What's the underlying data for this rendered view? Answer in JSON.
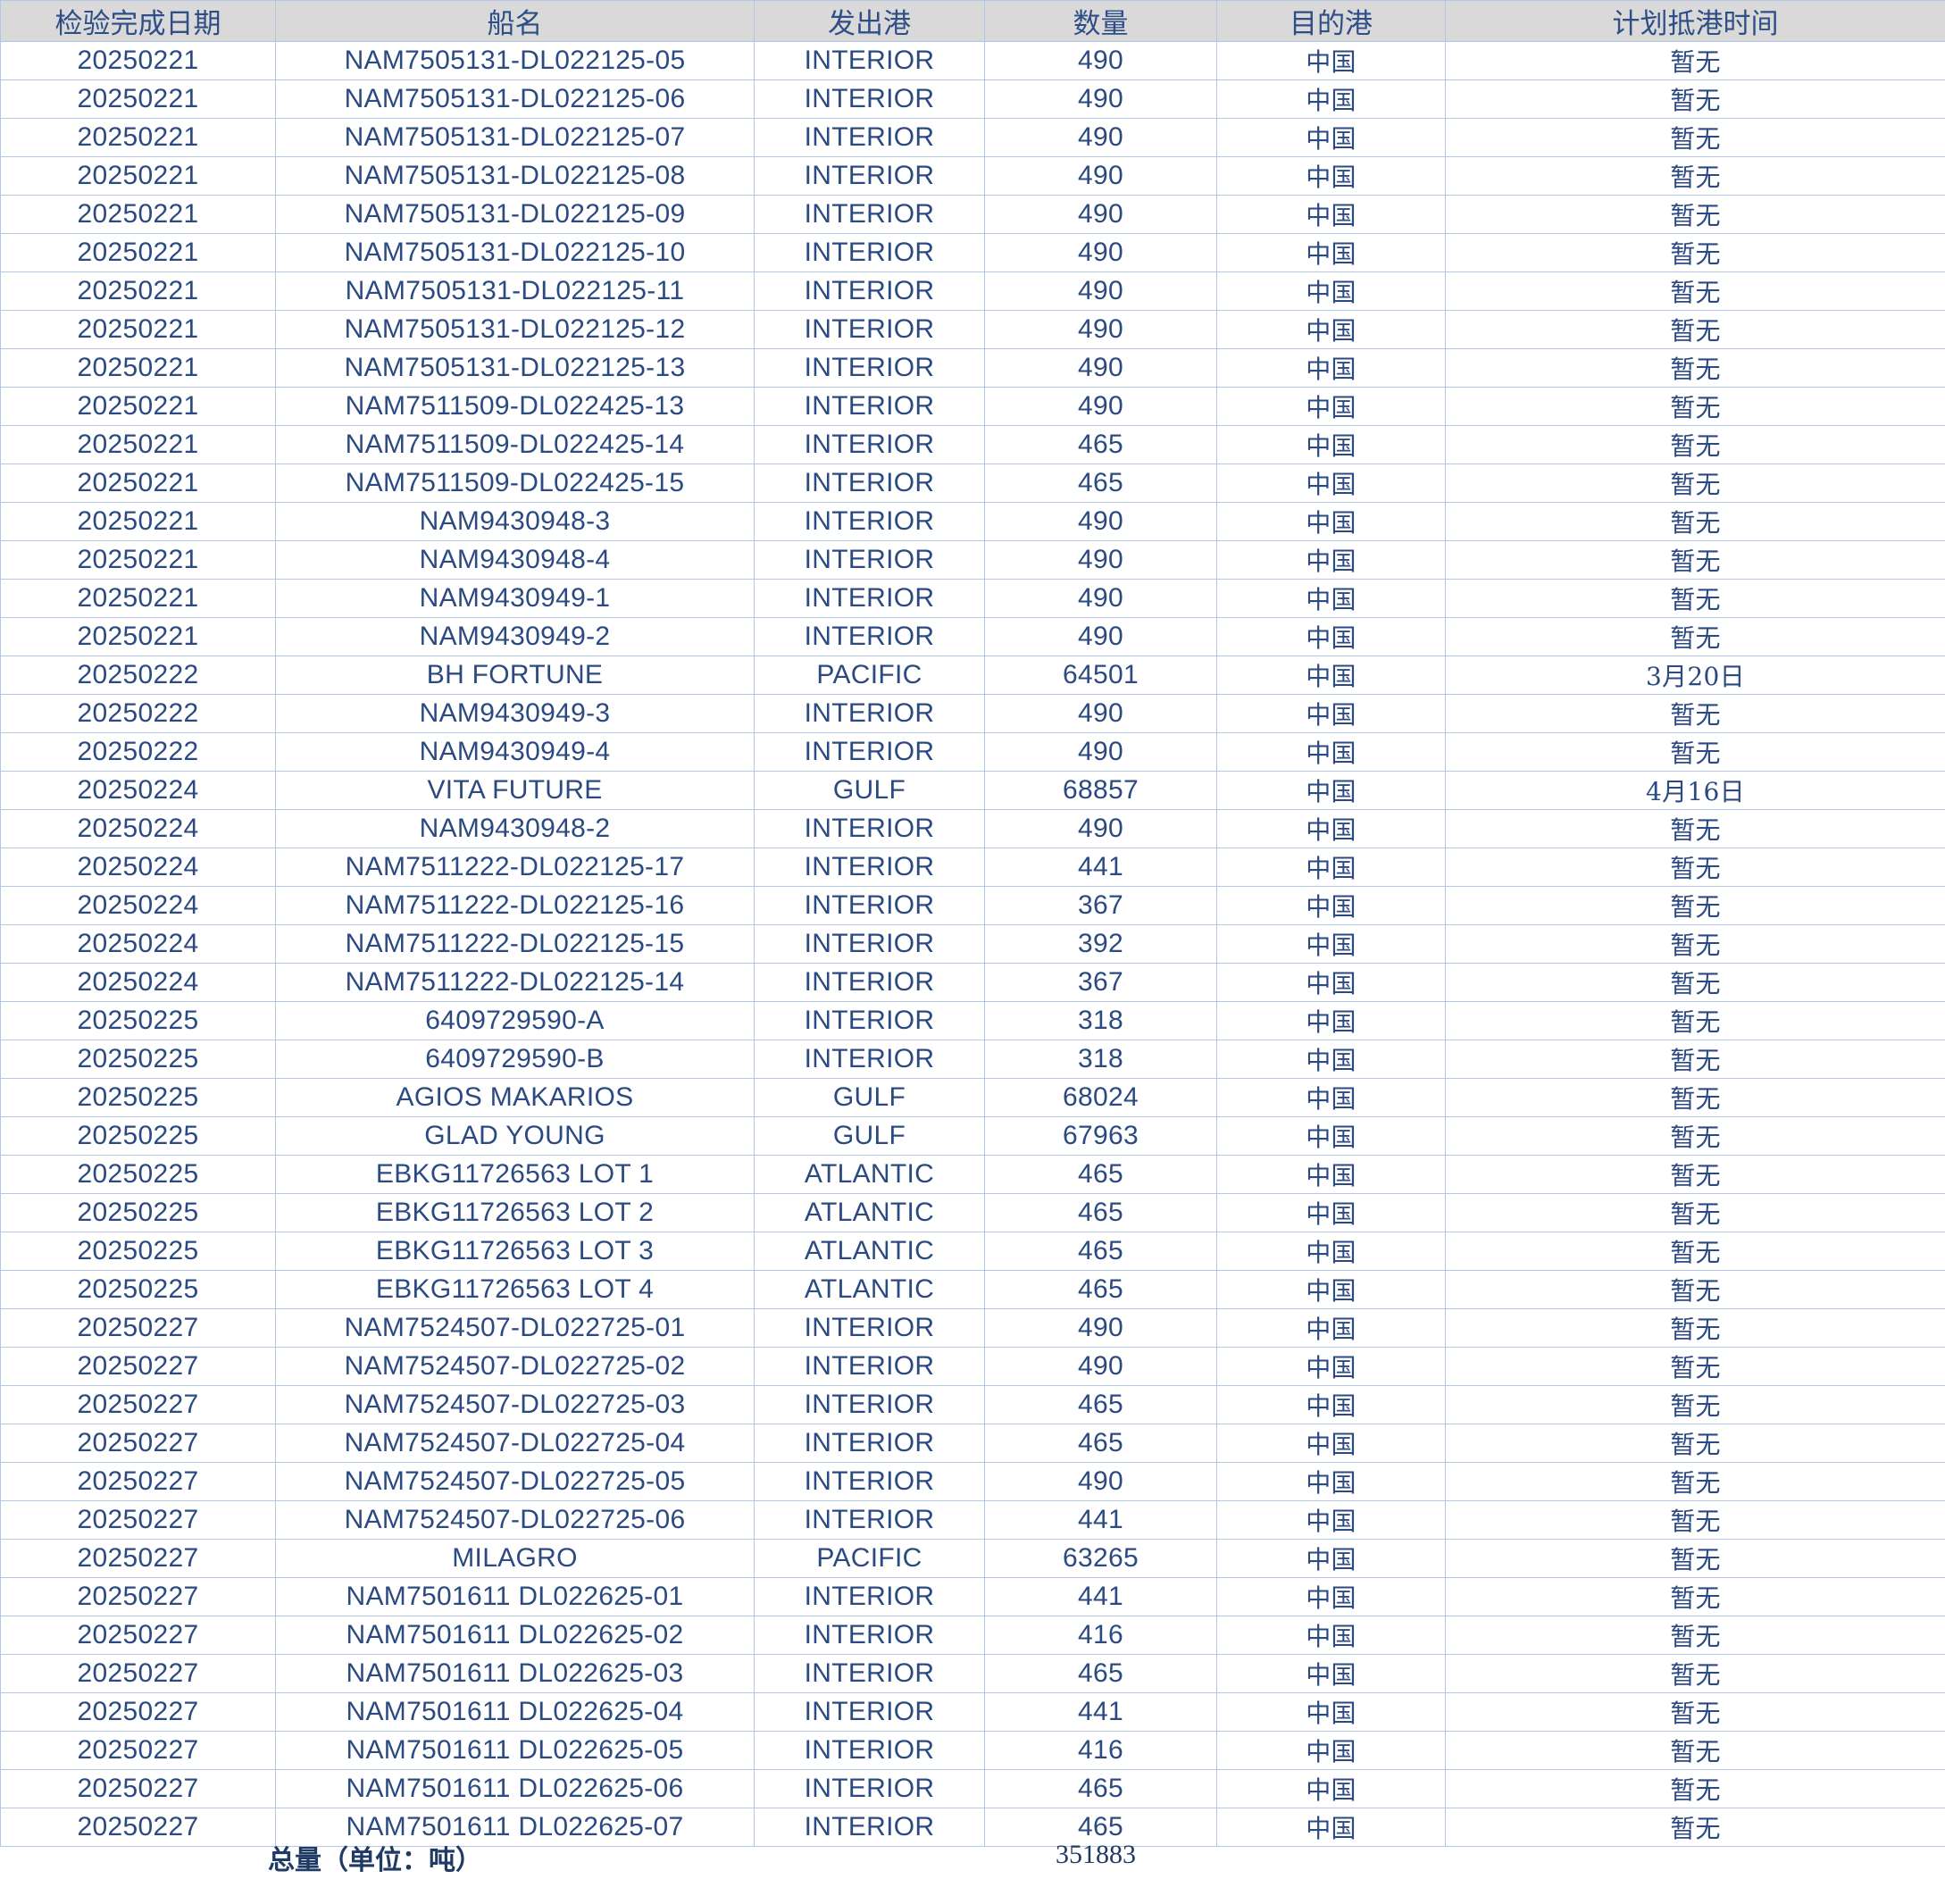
{
  "headers": [
    "检验完成日期",
    "船名",
    "发出港",
    "数量",
    "目的港",
    "计划抵港时间"
  ],
  "rows": [
    [
      "20250221",
      "NAM7505131-DL022125-05",
      "INTERIOR",
      "490",
      "中国",
      "暂无"
    ],
    [
      "20250221",
      "NAM7505131-DL022125-06",
      "INTERIOR",
      "490",
      "中国",
      "暂无"
    ],
    [
      "20250221",
      "NAM7505131-DL022125-07",
      "INTERIOR",
      "490",
      "中国",
      "暂无"
    ],
    [
      "20250221",
      "NAM7505131-DL022125-08",
      "INTERIOR",
      "490",
      "中国",
      "暂无"
    ],
    [
      "20250221",
      "NAM7505131-DL022125-09",
      "INTERIOR",
      "490",
      "中国",
      "暂无"
    ],
    [
      "20250221",
      "NAM7505131-DL022125-10",
      "INTERIOR",
      "490",
      "中国",
      "暂无"
    ],
    [
      "20250221",
      "NAM7505131-DL022125-11",
      "INTERIOR",
      "490",
      "中国",
      "暂无"
    ],
    [
      "20250221",
      "NAM7505131-DL022125-12",
      "INTERIOR",
      "490",
      "中国",
      "暂无"
    ],
    [
      "20250221",
      "NAM7505131-DL022125-13",
      "INTERIOR",
      "490",
      "中国",
      "暂无"
    ],
    [
      "20250221",
      "NAM7511509-DL022425-13",
      "INTERIOR",
      "490",
      "中国",
      "暂无"
    ],
    [
      "20250221",
      "NAM7511509-DL022425-14",
      "INTERIOR",
      "465",
      "中国",
      "暂无"
    ],
    [
      "20250221",
      "NAM7511509-DL022425-15",
      "INTERIOR",
      "465",
      "中国",
      "暂无"
    ],
    [
      "20250221",
      "NAM9430948-3",
      "INTERIOR",
      "490",
      "中国",
      "暂无"
    ],
    [
      "20250221",
      "NAM9430948-4",
      "INTERIOR",
      "490",
      "中国",
      "暂无"
    ],
    [
      "20250221",
      "NAM9430949-1",
      "INTERIOR",
      "490",
      "中国",
      "暂无"
    ],
    [
      "20250221",
      "NAM9430949-2",
      "INTERIOR",
      "490",
      "中国",
      "暂无"
    ],
    [
      "20250222",
      "BH FORTUNE",
      "PACIFIC",
      "64501",
      "中国",
      "3月20日"
    ],
    [
      "20250222",
      "NAM9430949-3",
      "INTERIOR",
      "490",
      "中国",
      "暂无"
    ],
    [
      "20250222",
      "NAM9430949-4",
      "INTERIOR",
      "490",
      "中国",
      "暂无"
    ],
    [
      "20250224",
      "VITA FUTURE",
      "GULF",
      "68857",
      "中国",
      "4月16日"
    ],
    [
      "20250224",
      "NAM9430948-2",
      "INTERIOR",
      "490",
      "中国",
      "暂无"
    ],
    [
      "20250224",
      "NAM7511222-DL022125-17",
      "INTERIOR",
      "441",
      "中国",
      "暂无"
    ],
    [
      "20250224",
      "NAM7511222-DL022125-16",
      "INTERIOR",
      "367",
      "中国",
      "暂无"
    ],
    [
      "20250224",
      "NAM7511222-DL022125-15",
      "INTERIOR",
      "392",
      "中国",
      "暂无"
    ],
    [
      "20250224",
      "NAM7511222-DL022125-14",
      "INTERIOR",
      "367",
      "中国",
      "暂无"
    ],
    [
      "20250225",
      "6409729590-A",
      "INTERIOR",
      "318",
      "中国",
      "暂无"
    ],
    [
      "20250225",
      "6409729590-B",
      "INTERIOR",
      "318",
      "中国",
      "暂无"
    ],
    [
      "20250225",
      "AGIOS MAKARIOS",
      "GULF",
      "68024",
      "中国",
      "暂无"
    ],
    [
      "20250225",
      "GLAD YOUNG",
      "GULF",
      "67963",
      "中国",
      "暂无"
    ],
    [
      "20250225",
      "EBKG11726563 LOT 1",
      "ATLANTIC",
      "465",
      "中国",
      "暂无"
    ],
    [
      "20250225",
      "EBKG11726563 LOT 2",
      "ATLANTIC",
      "465",
      "中国",
      "暂无"
    ],
    [
      "20250225",
      "EBKG11726563 LOT 3",
      "ATLANTIC",
      "465",
      "中国",
      "暂无"
    ],
    [
      "20250225",
      "EBKG11726563 LOT 4",
      "ATLANTIC",
      "465",
      "中国",
      "暂无"
    ],
    [
      "20250227",
      "NAM7524507-DL022725-01",
      "INTERIOR",
      "490",
      "中国",
      "暂无"
    ],
    [
      "20250227",
      "NAM7524507-DL022725-02",
      "INTERIOR",
      "490",
      "中国",
      "暂无"
    ],
    [
      "20250227",
      "NAM7524507-DL022725-03",
      "INTERIOR",
      "465",
      "中国",
      "暂无"
    ],
    [
      "20250227",
      "NAM7524507-DL022725-04",
      "INTERIOR",
      "465",
      "中国",
      "暂无"
    ],
    [
      "20250227",
      "NAM7524507-DL022725-05",
      "INTERIOR",
      "490",
      "中国",
      "暂无"
    ],
    [
      "20250227",
      "NAM7524507-DL022725-06",
      "INTERIOR",
      "441",
      "中国",
      "暂无"
    ],
    [
      "20250227",
      "MILAGRO",
      "PACIFIC",
      "63265",
      "中国",
      "暂无"
    ],
    [
      "20250227",
      "NAM7501611 DL022625-01",
      "INTERIOR",
      "441",
      "中国",
      "暂无"
    ],
    [
      "20250227",
      "NAM7501611 DL022625-02",
      "INTERIOR",
      "416",
      "中国",
      "暂无"
    ],
    [
      "20250227",
      "NAM7501611 DL022625-03",
      "INTERIOR",
      "465",
      "中国",
      "暂无"
    ],
    [
      "20250227",
      "NAM7501611 DL022625-04",
      "INTERIOR",
      "441",
      "中国",
      "暂无"
    ],
    [
      "20250227",
      "NAM7501611 DL022625-05",
      "INTERIOR",
      "416",
      "中国",
      "暂无"
    ],
    [
      "20250227",
      "NAM7501611 DL022625-06",
      "INTERIOR",
      "465",
      "中国",
      "暂无"
    ],
    [
      "20250227",
      "NAM7501611 DL022625-07",
      "INTERIOR",
      "465",
      "中国",
      "暂无"
    ]
  ],
  "total": {
    "label": "总量（单位：吨）",
    "value": "351883"
  }
}
